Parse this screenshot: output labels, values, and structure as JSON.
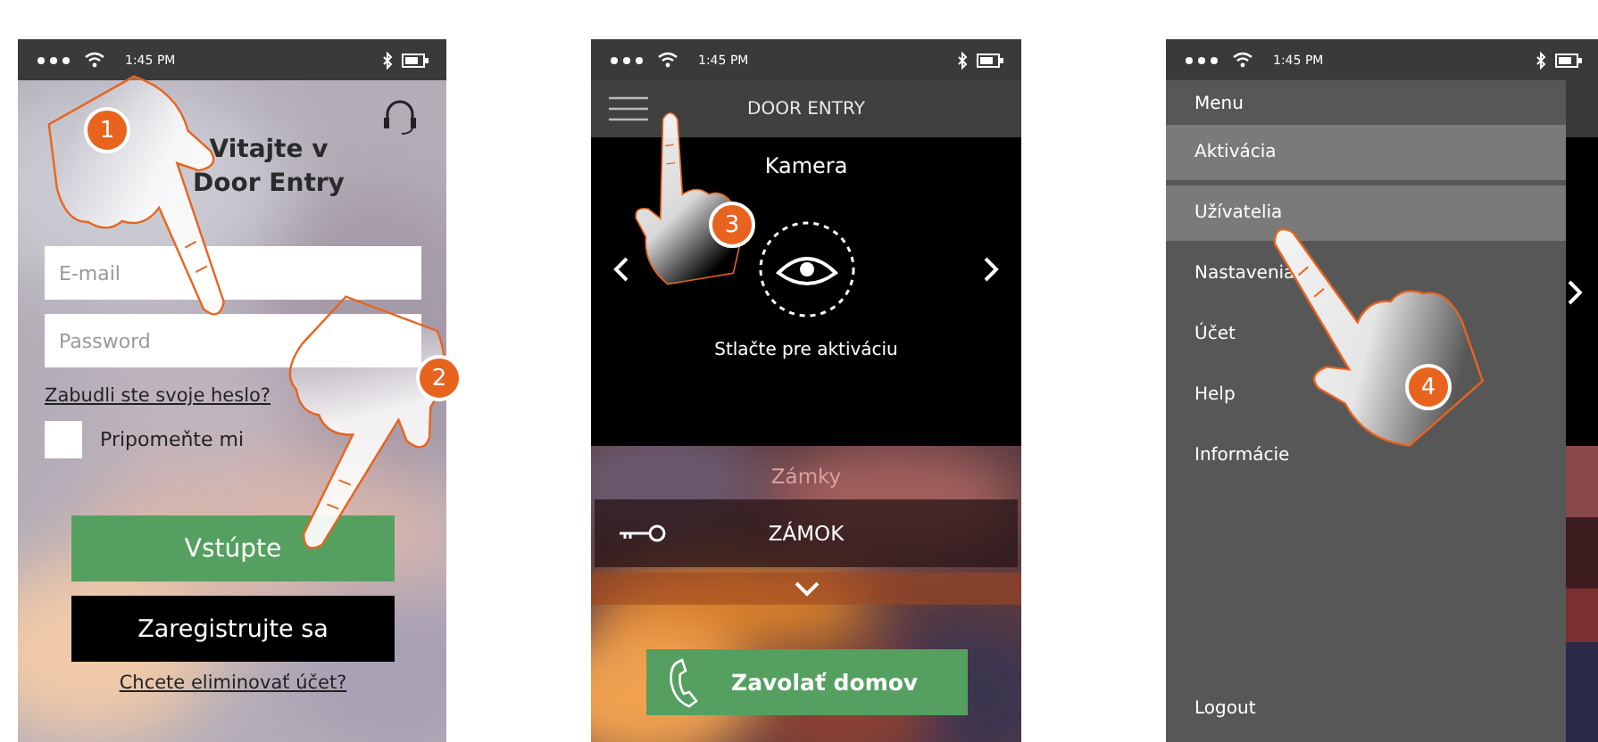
{
  "phones": [
    {
      "kind": "login",
      "time": "1:45 PM",
      "title_lines": [
        "Vitajte v",
        "Door Entry"
      ],
      "email": {
        "placeholder": "E-mail"
      },
      "password": {
        "placeholder": "Password"
      },
      "forgot_link": "Zabudli ste svoje heslo?",
      "remember": {
        "label": "Pripomeňte mi",
        "checked": false
      },
      "login_button": "Vstúpte",
      "register_button": "Zaregistrujte sa",
      "delete_link": "Chcete eliminovať účet?"
    },
    {
      "kind": "home",
      "time": "1:45 PM",
      "header_title": "DOOR ENTRY",
      "camera_title": "Kamera",
      "camera_hint": "Stlačte pre aktiváciu",
      "locks_title": "Zámky",
      "lock": "ZÁMOK",
      "call_button": "Zavolať domov"
    },
    {
      "kind": "menu",
      "time": "1:45 PM",
      "menu_title": "Menu",
      "items": [
        {
          "label": "Aktivácia",
          "highlighted": true
        },
        {
          "label": "Užívatelia",
          "highlighted": true
        },
        {
          "label": "Nastavenia",
          "highlighted": false
        },
        {
          "label": "Účet",
          "highlighted": false
        },
        {
          "label": "Help",
          "highlighted": false
        },
        {
          "label": "Informácie",
          "highlighted": false
        }
      ],
      "logout": "Logout"
    }
  ],
  "steps": [
    "1",
    "2",
    "3",
    "4"
  ]
}
